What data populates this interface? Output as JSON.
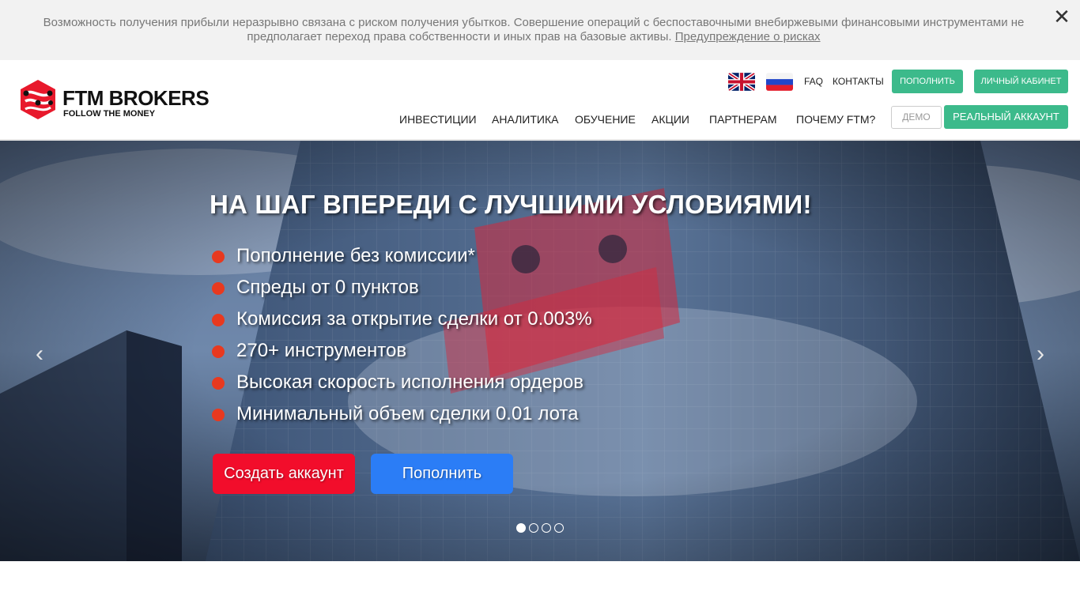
{
  "risk_banner": {
    "text": "Возможность получения прибыли неразрывно связана с риском получения убытков. Совершение операций с беспоставочными внебиржевыми финансовыми инструментами не предполагает переход права собственности и иных прав на базовые активы. ",
    "link": "Предупреждение о рисках",
    "close": "✕"
  },
  "logo": {
    "title": "FTM BROKERS",
    "subtitle": "FOLLOW THE MONEY"
  },
  "header": {
    "faq": "FAQ",
    "contacts": "КОНТАКТЫ",
    "deposit": "ПОПОЛНИТЬ",
    "cabinet": "ЛИЧНЫЙ КАБИНЕТ",
    "demo": "ДЕМО",
    "real_account": "РЕАЛЬНЫЙ АККАУНТ"
  },
  "nav": {
    "items": [
      "ИНВЕСТИЦИИ",
      "АНАЛИТИКА",
      "ОБУЧЕНИЕ",
      "АКЦИИ",
      "ПАРТНЕРАМ",
      "ПОЧЕМУ FTM?"
    ]
  },
  "hero": {
    "title": "НА ШАГ ВПЕРЕДИ С ЛУЧШИМИ УСЛОВИЯМИ!",
    "features": [
      "Пополнение без комиссии*",
      "Спреды от 0 пунктов",
      "Комиссия за открытие сделки от 0.003%",
      "270+ инструментов",
      "Высокая скорость исполнения ордеров",
      "Минимальный объем сделки 0.01 лота"
    ],
    "create_account": "Создать аккаунт",
    "deposit": "Пополнить",
    "prev_arrow": "‹",
    "next_arrow": "›",
    "slides_total": 4,
    "active_slide": 1
  },
  "colors": {
    "accent_green": "#3cba8b",
    "bullet_red": "#e8391f",
    "create_red": "#f20d2b",
    "deposit_blue": "#2b7df6",
    "logo_red": "#e8192c"
  },
  "icons": {
    "close": "close-icon",
    "flag_en": "uk-flag-icon",
    "flag_ru": "russia-flag-icon",
    "prev": "chevron-left-icon",
    "next": "chevron-right-icon"
  }
}
